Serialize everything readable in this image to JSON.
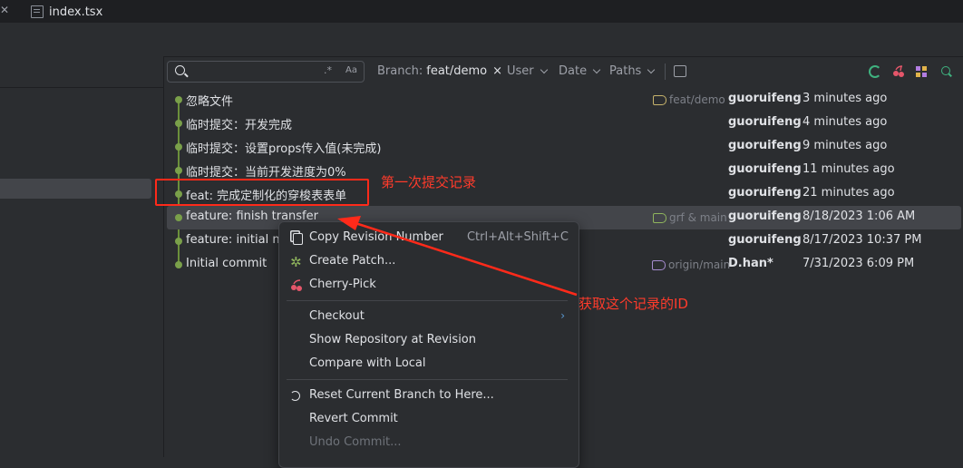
{
  "tabs": [
    {
      "label": "index.tsx",
      "icon": "file-lines-icon"
    }
  ],
  "toolbar": {
    "search_placeholder": "",
    "regex_label": ".*",
    "case_label": "Aa",
    "branch_label": "Branch:",
    "branch_value": "feat/demo",
    "branch_clear": "×",
    "user_label": "User",
    "date_label": "Date",
    "paths_label": "Paths"
  },
  "commits": [
    {
      "message": "忽略文件",
      "ref": "feat/demo",
      "author": "guoruifeng",
      "date": "3 minutes ago"
    },
    {
      "message": "临时提交：开发完成",
      "ref": "",
      "author": "guoruifeng",
      "date": "4 minutes ago"
    },
    {
      "message": "临时提交：设置props传入值(未完成)",
      "ref": "",
      "author": "guoruifeng",
      "date": "9 minutes ago"
    },
    {
      "message": "临时提交：当前开发进度为0%",
      "ref": "",
      "author": "guoruifeng",
      "date": "11 minutes ago"
    },
    {
      "message": "feat: 完成定制化的穿梭表表单",
      "ref": "",
      "author": "guoruifeng",
      "date": "21 minutes ago"
    },
    {
      "message": "feature: finish transfer",
      "ref": "grf & main",
      "author": "guoruifeng",
      "date": "8/18/2023 1:06 AM"
    },
    {
      "message": "feature: initial ne",
      "ref": "",
      "author": "guoruifeng",
      "date": "8/17/2023 10:37 PM"
    },
    {
      "message": "Initial commit",
      "ref": "origin/main",
      "author": "D.han*",
      "date": "7/31/2023 6:09 PM"
    }
  ],
  "context_menu": {
    "items": [
      {
        "label": "Copy Revision Number",
        "shortcut": "Ctrl+Alt+Shift+C",
        "icon": "copy-icon"
      },
      {
        "label": "Create Patch...",
        "icon": "patch-icon"
      },
      {
        "label": "Cherry-Pick",
        "icon": "cherry-icon"
      },
      {
        "label": "Checkout",
        "submenu": "›"
      },
      {
        "label": "Show Repository at Revision"
      },
      {
        "label": "Compare with Local"
      },
      {
        "label": "Reset Current Branch to Here...",
        "icon": "reset-icon"
      },
      {
        "label": "Revert Commit"
      },
      {
        "label": "Undo Commit...",
        "disabled": true
      }
    ]
  },
  "annotations": {
    "first_commit_note": "第一次提交记录",
    "get_id_note": "获取这个记录的ID"
  },
  "colors": {
    "background": "#2b2d30",
    "selection": "#43454a",
    "graph": "#7aa04a",
    "annotation": "#ff2a1a",
    "accent_green": "#3fb27f",
    "cherry_red": "#e5566a"
  }
}
